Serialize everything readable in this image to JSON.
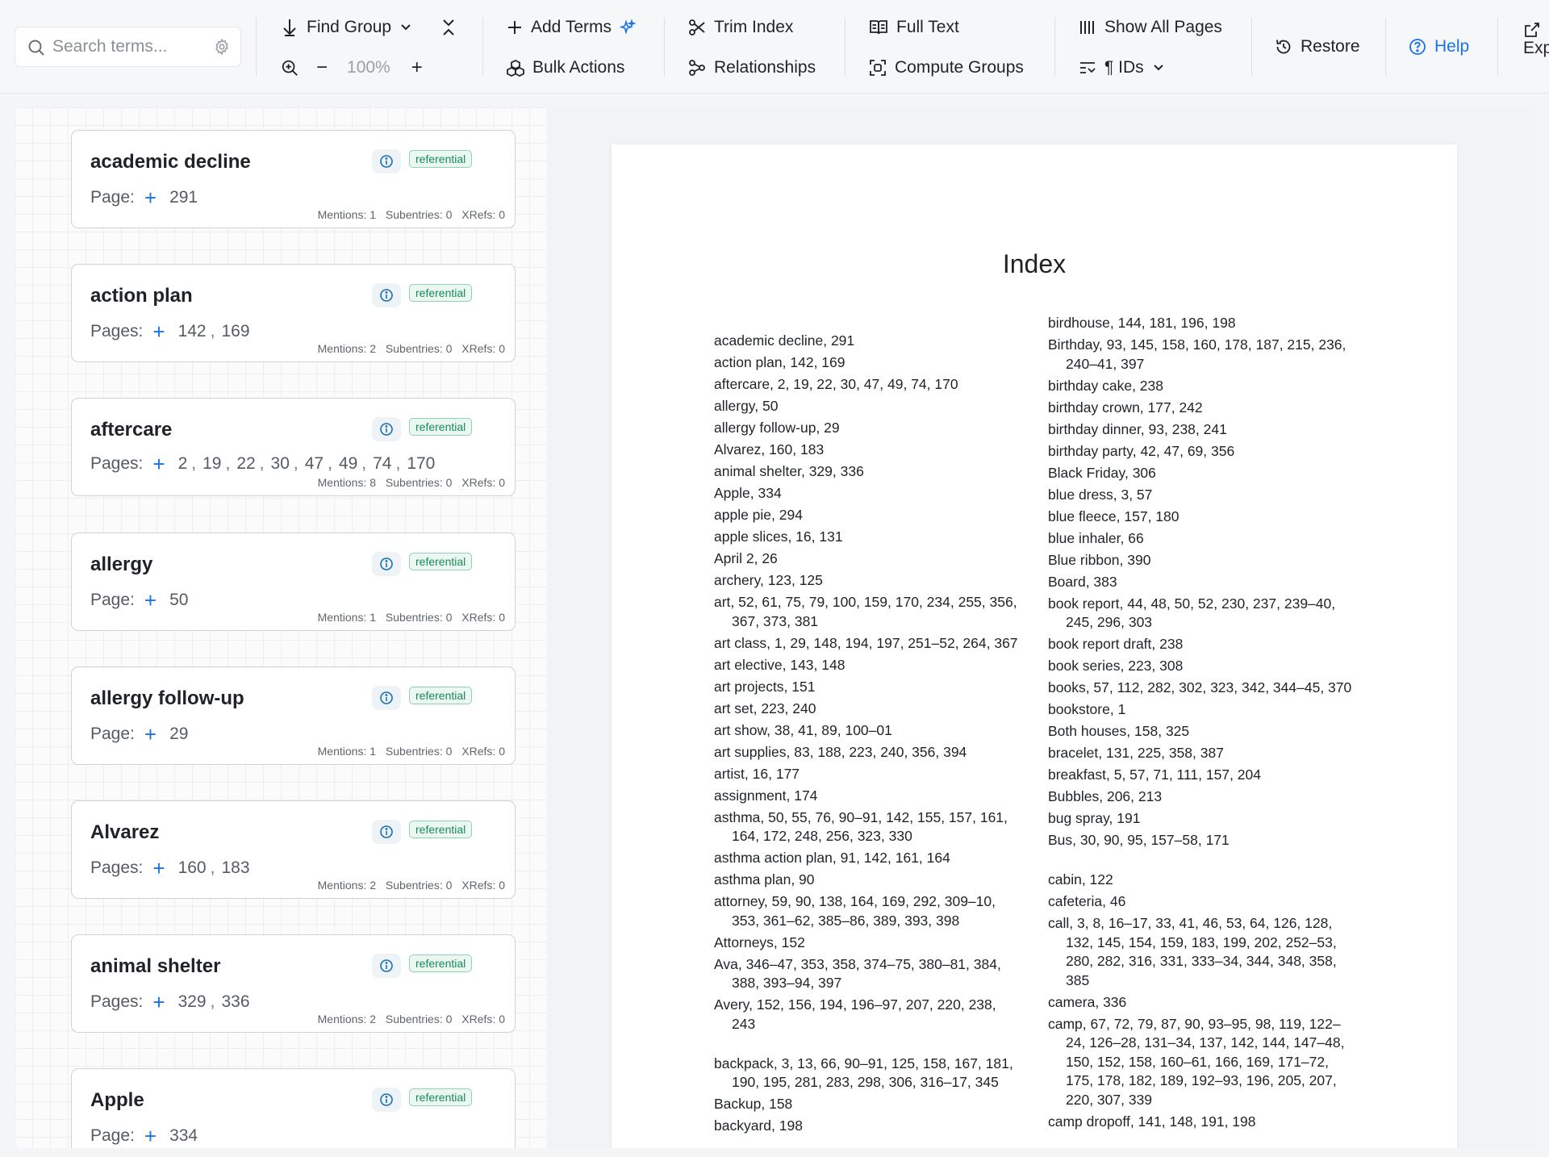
{
  "toolbar": {
    "search": {
      "placeholder": "Search terms..."
    },
    "find_group": "Find Group",
    "zoom": "100%",
    "zoom_out": "−",
    "zoom_in": "+",
    "add_terms": "Add Terms",
    "bulk_actions": "Bulk Actions",
    "trim_index": "Trim Index",
    "relationships": "Relationships",
    "full_text": "Full Text",
    "compute_groups": "Compute Groups",
    "show_all_pages": "Show All Pages",
    "ids": "¶ IDs",
    "restore": "Restore",
    "help": "Help",
    "export_partial": "Exp"
  },
  "cards": [
    {
      "term": "academic decline",
      "page_label": "Page:",
      "pages": [
        "291"
      ],
      "badge": "referential",
      "mentions": "Mentions: 1",
      "subentries": "Subentries: 0",
      "xrefs": "XRefs: 0"
    },
    {
      "term": "action plan",
      "page_label": "Pages:",
      "pages": [
        "142",
        "169"
      ],
      "badge": "referential",
      "mentions": "Mentions: 2",
      "subentries": "Subentries: 0",
      "xrefs": "XRefs: 0"
    },
    {
      "term": "aftercare",
      "page_label": "Pages:",
      "pages": [
        "2",
        "19",
        "22",
        "30",
        "47",
        "49",
        "74",
        "170"
      ],
      "badge": "referential",
      "mentions": "Mentions: 8",
      "subentries": "Subentries: 0",
      "xrefs": "XRefs: 0"
    },
    {
      "term": "allergy",
      "page_label": "Page:",
      "pages": [
        "50"
      ],
      "badge": "referential",
      "mentions": "Mentions: 1",
      "subentries": "Subentries: 0",
      "xrefs": "XRefs: 0"
    },
    {
      "term": "allergy follow-up",
      "page_label": "Page:",
      "pages": [
        "29"
      ],
      "badge": "referential",
      "mentions": "Mentions: 1",
      "subentries": "Subentries: 0",
      "xrefs": "XRefs: 0"
    },
    {
      "term": "Alvarez",
      "page_label": "Pages:",
      "pages": [
        "160",
        "183"
      ],
      "badge": "referential",
      "mentions": "Mentions: 2",
      "subentries": "Subentries: 0",
      "xrefs": "XRefs: 0"
    },
    {
      "term": "animal shelter",
      "page_label": "Pages:",
      "pages": [
        "329",
        "336"
      ],
      "badge": "referential",
      "mentions": "Mentions: 2",
      "subentries": "Subentries: 0",
      "xrefs": "XRefs: 0"
    },
    {
      "term": "Apple",
      "page_label": "Page:",
      "pages": [
        "334"
      ],
      "badge": "referential",
      "mentions": "",
      "subentries": "",
      "xrefs": ""
    }
  ],
  "index_page": {
    "title": "Index",
    "col1": [
      "academic decline, 291",
      "action plan, 142, 169",
      "aftercare, 2, 19, 22, 30, 47, 49, 74, 170",
      "allergy, 50",
      "allergy follow-up, 29",
      "Alvarez, 160, 183",
      "animal shelter, 329, 336",
      "Apple, 334",
      "apple pie, 294",
      "apple slices, 16, 131",
      "April 2, 26",
      "archery, 123, 125",
      "art, 52, 61, 75, 79, 100, 159, 170, 234, 255, 356, 367, 373, 381",
      "art class, 1, 29, 148, 194, 197, 251–52, 264, 367",
      "art elective, 143, 148",
      "art projects, 151",
      "art set, 223, 240",
      "art show, 38, 41, 89, 100–01",
      "art supplies, 83, 188, 223, 240, 356, 394",
      "artist, 16, 177",
      "assignment, 174",
      "asthma, 50, 55, 76, 90–91, 142, 155, 157, 161, 164, 172, 248, 256, 323, 330",
      "asthma action plan, 91, 142, 161, 164",
      "asthma plan, 90",
      "attorney, 59, 90, 138, 164, 169, 292, 309–10, 353, 361–62, 385–86, 389, 393, 398",
      "Attorneys, 152",
      "Ava, 346–47, 353, 358, 374–75, 380–81, 384, 388, 393–94, 397",
      "Avery, 152, 156, 194, 196–97, 207, 220, 238, 243",
      "",
      "backpack, 3, 13, 66, 90–91, 125, 158, 167, 181, 190, 195, 281, 283, 298, 306, 316–17, 345",
      "Backup, 158",
      "backyard, 198"
    ],
    "col2": [
      "birdhouse, 144, 181, 196, 198",
      "Birthday, 93, 145, 158, 160, 178, 187, 215, 236, 240–41, 397",
      "birthday cake, 238",
      "birthday crown, 177, 242",
      "birthday dinner, 93, 238, 241",
      "birthday party, 42, 47, 69, 356",
      "Black Friday, 306",
      "blue dress, 3, 57",
      "blue fleece, 157, 180",
      "blue inhaler, 66",
      "Blue ribbon, 390",
      "Board, 383",
      "book report, 44, 48, 50, 52, 230, 237, 239–40, 245, 296, 303",
      "book report draft, 238",
      "book series, 223, 308",
      "books, 57, 112, 282, 302, 323, 342, 344–45, 370",
      "bookstore, 1",
      "Both houses, 158, 325",
      "bracelet, 131, 225, 358, 387",
      "breakfast, 5, 57, 71, 111, 157, 204",
      "Bubbles, 206, 213",
      "bug spray, 191",
      "Bus, 30, 90, 95, 157–58, 171",
      "",
      "cabin, 122",
      "cafeteria, 46",
      "call, 3, 8, 16–17, 33, 41, 46, 53, 64, 126, 128, 132, 145, 154, 159, 183, 199, 202, 252–53, 280, 282, 316, 331, 333–34, 344, 348, 358, 385",
      "camera, 336",
      "camp, 67, 72, 79, 87, 90, 93–95, 98, 119, 122–24, 126–28, 131–34, 137, 142, 144, 147–48, 150, 152, 158, 160–61, 166, 169, 171–72, 175, 178, 182, 189, 192–93, 196, 205, 207, 220, 307, 339",
      "camp dropoff, 141, 148, 191, 198"
    ]
  },
  "colors": {
    "accent": "#1a73e8",
    "badge": "#1a8a5a",
    "info": "#1a6fb0"
  }
}
